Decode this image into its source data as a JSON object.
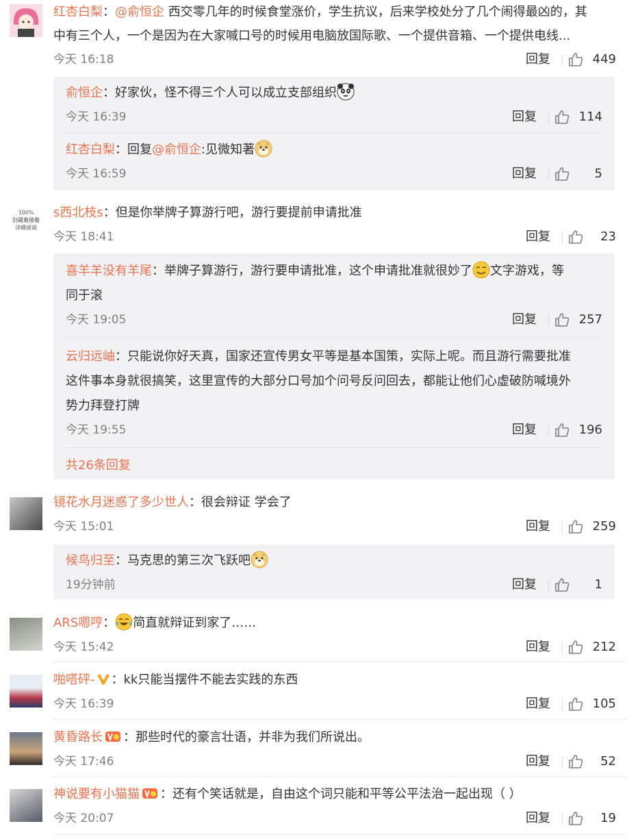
{
  "comments": [
    {
      "user": "红杏白梨",
      "sep": "：",
      "mention": "@俞恒企",
      "text_line1": " 西交零几年的时候食堂涨价，学生抗议，后来学校处分了几个闹得最凶的，其",
      "text_line2": "中有三个人，一个是因为在大家喊口号的时候用电脑放国际歌、一个提供音箱、一个提供电线...",
      "time": "今天 16:18",
      "reply": "回复",
      "likes": "449",
      "avatar_icon": "anime-girl-avatar",
      "replies": [
        {
          "user": "俞恒企",
          "sep": "：",
          "text": "好家伙，怪不得三个人可以成立支部组织",
          "time": "今天 16:39",
          "reply": "回复",
          "likes": "114",
          "emoji": "doge-emoji"
        },
        {
          "user": "红杏白梨",
          "sep": "：",
          "text_pre": "回复",
          "mention": "@俞恒企",
          "text": ":见微知著",
          "time": "今天 16:59",
          "reply": "回复",
          "likes": "5",
          "emoji": "doge-emoji"
        }
      ]
    },
    {
      "user": "s西北枝s",
      "sep": "：",
      "text": "但是你举牌子算游行吧，游行要提前申请批准",
      "time": "今天 18:41",
      "reply": "回复",
      "likes": "23",
      "avatar_text1": "别藏着掖着",
      "avatar_text2": "详细说说",
      "avatar_pct": "100%",
      "replies": [
        {
          "user": "喜羊羊没有羊尾",
          "sep": "：",
          "text_line1": "举牌子算游行，游行要申请批准，这个申请批准就很妙了",
          "text_after": "文字游戏，等",
          "text_line2": "同于滚",
          "time": "今天 19:05",
          "reply": "回复",
          "likes": "257",
          "emoji": "smirk-emoji"
        },
        {
          "user": "云归远岫",
          "sep": "：",
          "text_line1": "只能说你好天真，国家还宣传男女平等是基本国策，实际上呢。而且游行需要批准",
          "text_line2": "这件事本身就很搞笑，这里宣传的大部分口号加个问号反问回去，都能让他们心虚破防喊境外",
          "text_line3": "势力拜登打牌",
          "time": "今天 19:55",
          "reply": "回复",
          "likes": "196"
        }
      ],
      "more": "共26条回复"
    },
    {
      "user": "镜花水月迷惑了多少世人",
      "sep": "：",
      "text": "很会辩证 学会了",
      "time": "今天 15:01",
      "reply": "回复",
      "likes": "259",
      "replies": [
        {
          "user": "候鸟归至",
          "sep": "：",
          "text": "马克思的第三次飞跃吧",
          "time": "19分钟前",
          "reply": "回复",
          "likes": "1",
          "emoji": "doge-emoji"
        }
      ]
    },
    {
      "user": "ARS嗯哼",
      "sep": "：",
      "text": "简直就辩证到家了……",
      "time": "今天 15:42",
      "reply": "回复",
      "likes": "212",
      "emoji": "laugh-cry-emoji"
    },
    {
      "user": "啪嗒砰-",
      "sep": "：",
      "text": "kk只能当摆件不能去实践的东西",
      "time": "今天 16:39",
      "reply": "回复",
      "likes": "105",
      "badge": "v-badge"
    },
    {
      "user": "黄昏路长",
      "sep": "：",
      "text": "那些时代的豪言壮语，并非为我们所说出。",
      "time": "今天 17:46",
      "reply": "回复",
      "likes": "52",
      "badge": "vip-badge"
    },
    {
      "user": "神说要有小猫猫",
      "sep": "：",
      "text": "还有个笑话就是，自由这个词只能和平等公平法治一起出现（ ）",
      "time": "今天 20:07",
      "reply": "回复",
      "likes": "19",
      "badge": "vip-badge"
    }
  ],
  "colors": {
    "accent": "#eb7350",
    "subbg": "#f2f2f5",
    "time": "#808080"
  }
}
